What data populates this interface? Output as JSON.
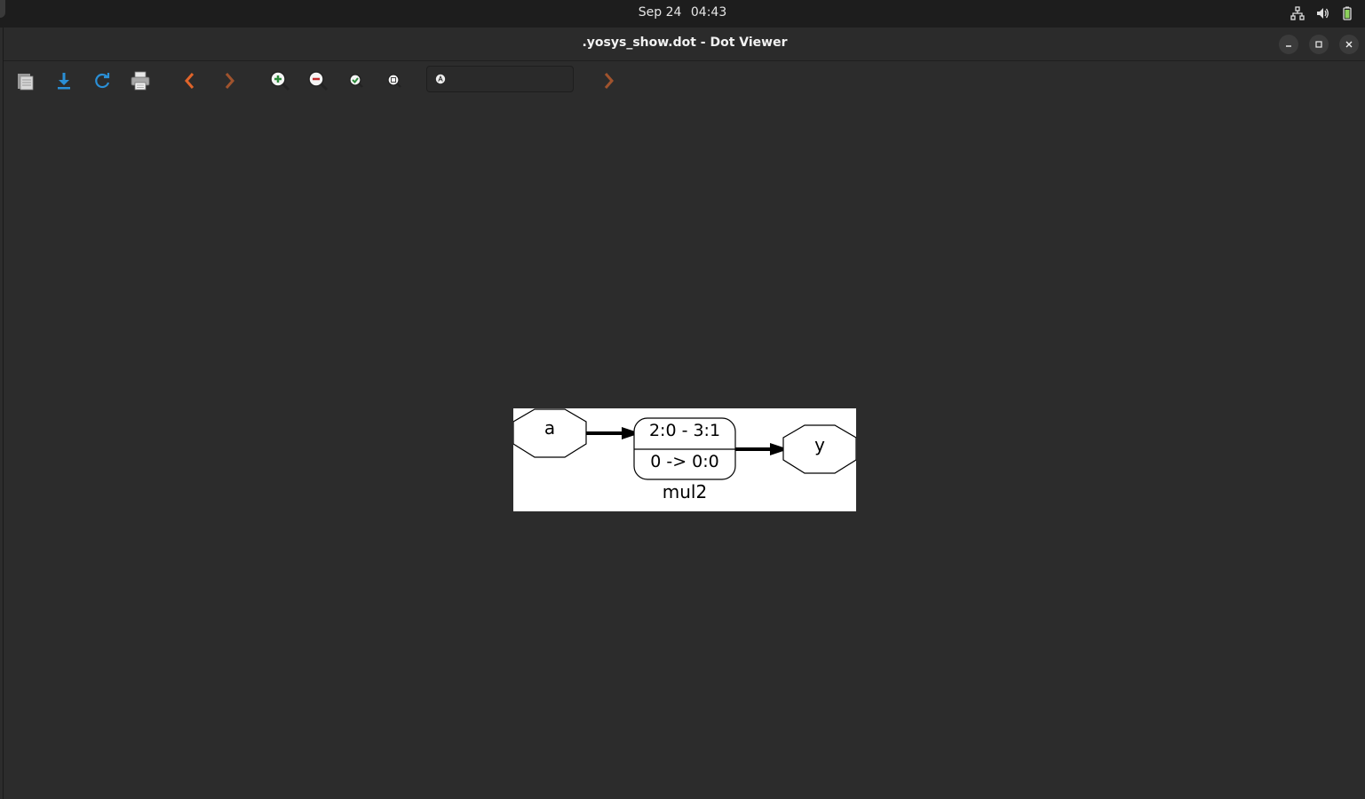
{
  "topbar": {
    "date": "Sep 24",
    "time": "04:43",
    "tray_icons": [
      "network-icon",
      "volume-icon",
      "battery-icon"
    ]
  },
  "window": {
    "title": ".yosys_show.dot - Dot Viewer",
    "controls": [
      "minimize-icon",
      "restore-icon",
      "close-icon"
    ]
  },
  "toolbar": {
    "buttons": [
      "open-file-icon",
      "save-download-icon",
      "reload-icon",
      "print-icon",
      "back-icon",
      "forward-icon",
      "zoom-in-icon",
      "zoom-out-icon",
      "zoom-fit-icon",
      "zoom-100-icon"
    ],
    "search": {
      "value": "",
      "placeholder": ""
    },
    "find_next": "find-next-icon"
  },
  "graph": {
    "nodes": {
      "input": "a",
      "cell_top": "2:0 - 3:1",
      "cell_bottom": "0 -> 0:0",
      "output": "y"
    },
    "label": "mul2"
  },
  "colors": {
    "background": "#2c2c2c",
    "topbar": "#1d1d1d",
    "accent_orange": "#e0642a",
    "accent_blue": "#2a8fd6",
    "accent_green": "#2c8a3a",
    "accent_red": "#c0292a"
  }
}
